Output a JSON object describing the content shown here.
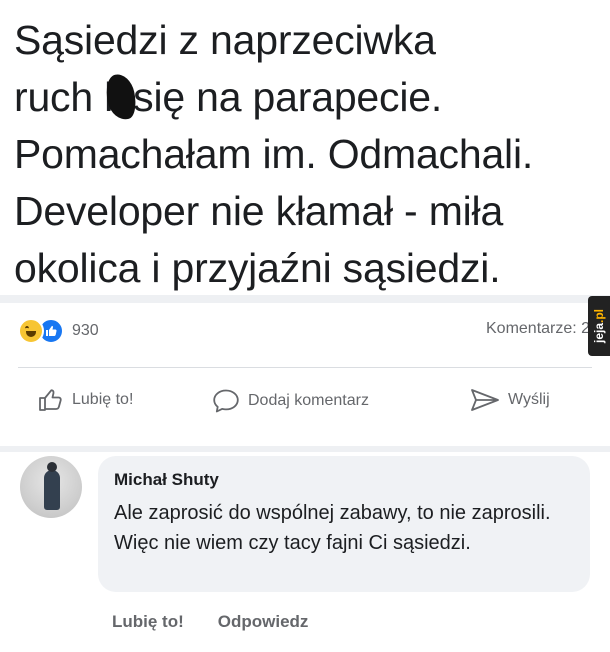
{
  "post": {
    "text": "Sąsiedzi z naprzeciwka\nruch  li się na parapecie.\nPomachałam im. Odmachali.\nDeveloper nie kłamał - miła\nokolica i przyjaźni sąsiedzi."
  },
  "stats": {
    "reaction_count": "930",
    "comments_label": "Komentarze: 2",
    "reactions": [
      "haha-icon",
      "like-icon"
    ]
  },
  "watermark": {
    "text_main": "jeja",
    "text_tld": ".pl"
  },
  "actions": {
    "like_label": "Lubię to!",
    "comment_label": "Dodaj komentarz",
    "share_label": "Wyślij"
  },
  "comment": {
    "author": "Michał Shuty",
    "text": "Ale zaprosić do wspólnej zabawy, to nie zaprosili. Więc nie wiem czy tacy fajni Ci sąsiedzi.",
    "like_label": "Lubię to!",
    "reply_label": "Odpowiedz"
  },
  "colors": {
    "text": "#1c1e21",
    "secondary": "#65676b",
    "like_blue": "#1877f2",
    "bubble": "#f0f2f5"
  }
}
